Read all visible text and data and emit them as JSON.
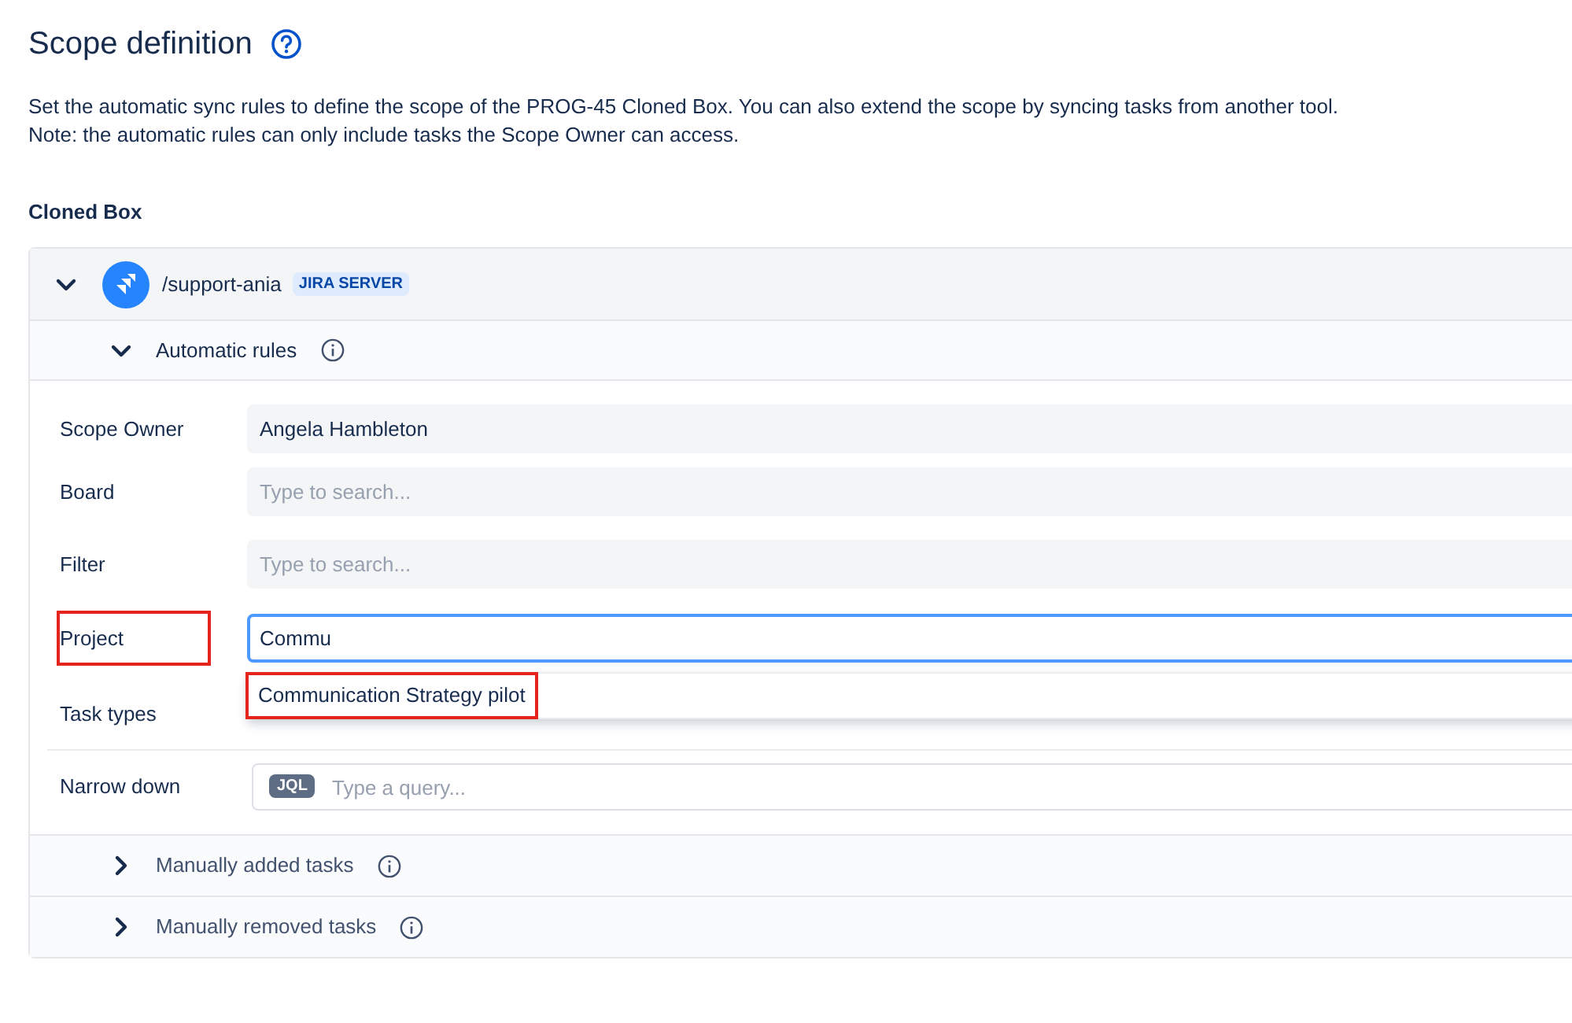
{
  "title": "Scope definition",
  "description": [
    "Set the automatic sync rules to define the scope of the PROG-45 Cloned Box. You can also extend the scope by syncing tasks from another tool.",
    "Note: the automatic rules can only include tasks the Scope Owner can access."
  ],
  "section_title": "Cloned Box",
  "source": {
    "name": "/support-ania",
    "badge": "JIRA SERVER",
    "expanded": true
  },
  "automatic_rules": {
    "label": "Automatic rules",
    "expanded": true
  },
  "fields": [
    {
      "label": "Scope Owner",
      "value": "Angela Hambleton",
      "highlighted": false
    },
    {
      "label": "Board",
      "placeholder": "Type to search...",
      "highlighted": false
    },
    {
      "label": "Filter",
      "placeholder": "Type to search...",
      "highlighted": false
    },
    {
      "label": "Project",
      "value": "Commu",
      "focused": true,
      "highlighted": true,
      "suggestions": [
        {
          "label": "Communication Strategy pilot",
          "highlighted": true
        }
      ]
    },
    {
      "label": "Task types",
      "highlighted": false
    }
  ],
  "narrow_down": {
    "label": "Narrow down",
    "tag": "JQL",
    "placeholder": "Type a query..."
  },
  "sections": [
    {
      "label": "Manually added tasks",
      "expanded": false
    },
    {
      "label": "Manually removed tasks",
      "expanded": false
    }
  ]
}
